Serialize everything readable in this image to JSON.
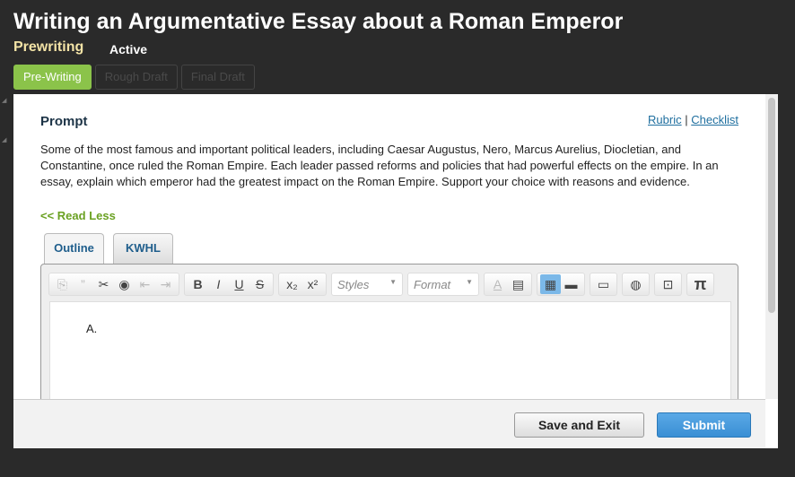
{
  "header": {
    "title": "Writing an Argumentative Essay about a Roman Emperor",
    "stage": "Prewriting",
    "status": "Active"
  },
  "steps": [
    "Pre-Writing",
    "Rough Draft",
    "Final Draft"
  ],
  "prompt": {
    "heading": "Prompt",
    "rubric": "Rubric",
    "separator": "|",
    "checklist": "Checklist",
    "text": "Some of the most famous and important political leaders, including Caesar Augustus, Nero, Marcus Aurelius, Diocletian, and Constantine, once ruled the Roman Empire. Each leader passed reforms and policies that had powerful effects on the empire. In an essay, explain which emperor had the greatest impact on the Roman Empire. Support your choice with reasons and evidence.",
    "read_less": "<< Read Less"
  },
  "tabs": [
    "Outline",
    "KWHL"
  ],
  "toolbar": {
    "styles": "Styles",
    "format": "Format"
  },
  "editor": {
    "content": "A."
  },
  "footer": {
    "save": "Save and Exit",
    "submit": "Submit"
  }
}
